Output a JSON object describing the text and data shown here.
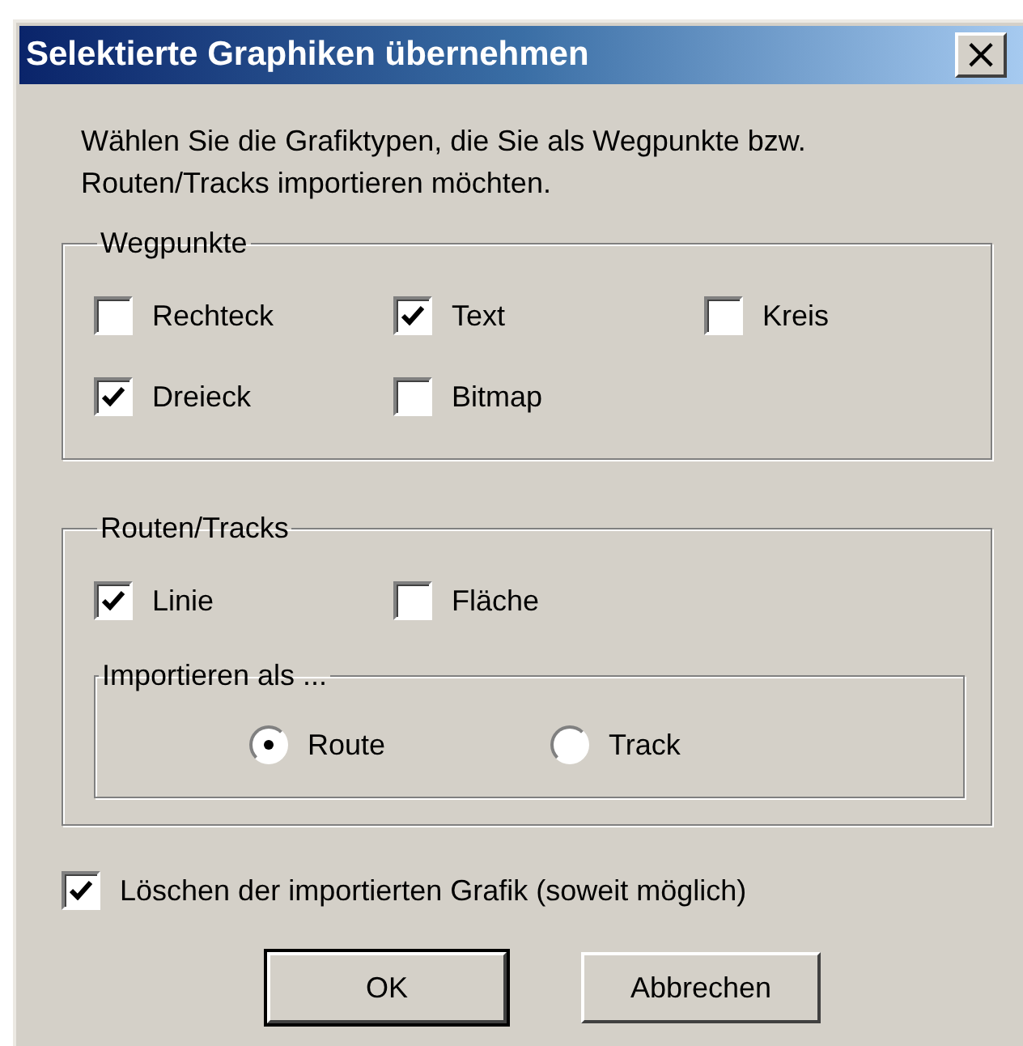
{
  "window": {
    "title": "Selektierte Graphiken übernehmen",
    "close": "×"
  },
  "intro": "Wählen Sie die Grafiktypen, die Sie als Wegpunkte bzw. Routen/Tracks importieren möchten.",
  "waypoints": {
    "title": "Wegpunkte",
    "items": [
      {
        "label": "Rechteck",
        "checked": false
      },
      {
        "label": "Text",
        "checked": true
      },
      {
        "label": "Kreis",
        "checked": false
      },
      {
        "label": "Dreieck",
        "checked": true
      },
      {
        "label": "Bitmap",
        "checked": false
      }
    ]
  },
  "routes": {
    "title": "Routen/Tracks",
    "items": [
      {
        "label": "Linie",
        "checked": true
      },
      {
        "label": "Fläche",
        "checked": false
      }
    ],
    "import_as": {
      "title": "Importieren als ...",
      "options": [
        {
          "label": "Route",
          "selected": true
        },
        {
          "label": "Track",
          "selected": false
        }
      ]
    }
  },
  "delete_option": {
    "label": "Löschen der importierten Grafik (soweit möglich)",
    "checked": true
  },
  "buttons": [
    {
      "label": "OK",
      "default": true
    },
    {
      "label": "Abbrechen",
      "default": false
    }
  ]
}
